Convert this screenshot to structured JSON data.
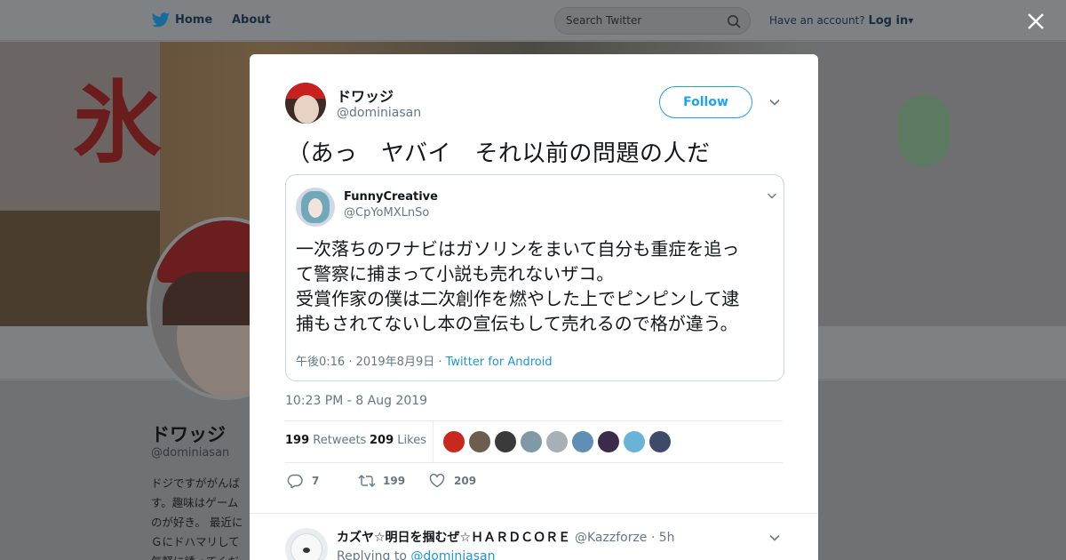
{
  "nav": {
    "home": "Home",
    "about": "About",
    "search_placeholder": "Search Twitter",
    "account_prompt": "Have an account?",
    "login": "Log in"
  },
  "background_profile": {
    "banner_kanji": "氷",
    "name": "ドワッジ",
    "handle": "@dominiasan",
    "bio_lines": [
      "ドジですががんば",
      "す。趣味はゲーム",
      "のが好き。 最近に",
      "Ｇにドハマリして",
      "気軽に誘ってくだ"
    ]
  },
  "tweet": {
    "author_name": "ドワッジ",
    "author_handle": "@dominiasan",
    "follow_label": "Follow",
    "text": "（あっ　ヤバイ　それ以前の問題の人だ",
    "timestamp": "10:23 PM - 8 Aug 2019",
    "retweets_count": "199",
    "retweets_label": "Retweets",
    "likes_count": "209",
    "likes_label": "Likes",
    "reply_count": "7",
    "retweet_action_count": "199",
    "like_action_count": "209",
    "liker_colors": [
      "#c9281c",
      "#6b5e4e",
      "#3a3a3a",
      "#7f9aa6",
      "#a7b0b6",
      "#5f8fb4",
      "#3b2a4a",
      "#6ab3d8",
      "#3f4a6b"
    ]
  },
  "quoted": {
    "name": "FunnyCreative",
    "handle": "@CpYoMXLnSo",
    "text_lines": [
      "一次落ちのワナビはガソリンをまいて自分も重症を追っ",
      "て警察に捕まって小説も売れないザコ。",
      "受賞作家の僕は二次創作を燃やした上でピンピンして逮",
      "捕もされてないし本の宣伝もして売れるので格が違う。"
    ],
    "time": "午後0:16 · 2019年8月9日 · ",
    "source": "Twitter for Android"
  },
  "reply": {
    "name": "カズヤ☆明日を掴むぜ☆ＨＡＲＤＣＯＲＥ",
    "handle_time": "@Kazzforze · 5h",
    "replying_prefix": "Replying to",
    "replying_to": "@dominiasan"
  },
  "colors": {
    "accent": "#1da1f2",
    "link": "#1b95e0",
    "muted": "#657786",
    "text": "#14171a"
  }
}
